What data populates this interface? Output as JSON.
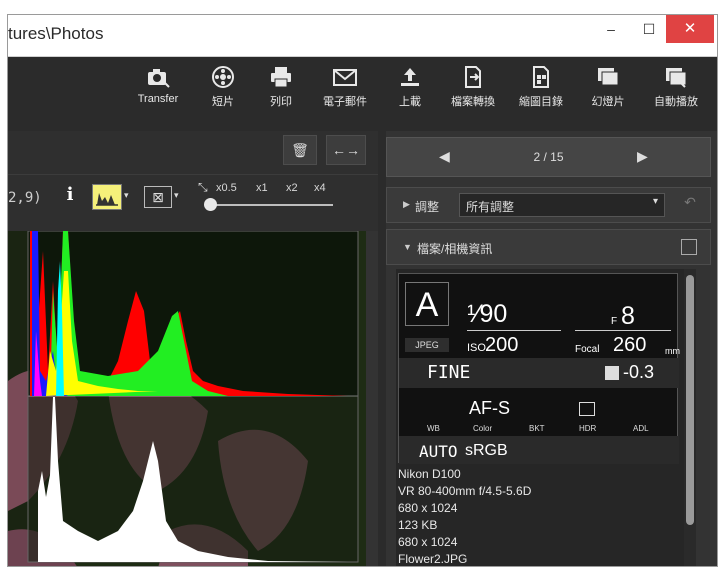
{
  "window": {
    "title": "tures\\Photos",
    "min_glyph": "‒",
    "max_glyph": "☐",
    "close_glyph": "✕"
  },
  "toolbar": {
    "items": [
      {
        "label": "Transfer",
        "icon": "camera-transfer-icon"
      },
      {
        "label": "短片",
        "icon": "film-reel-icon"
      },
      {
        "label": "列印",
        "icon": "printer-icon"
      },
      {
        "label": "電子郵件",
        "icon": "envelope-icon"
      },
      {
        "label": "上載",
        "icon": "upload-icon"
      },
      {
        "label": "檔案轉換",
        "icon": "file-convert-icon"
      },
      {
        "label": "縮圖目錄",
        "icon": "thumbnail-list-icon"
      },
      {
        "label": "幻燈片",
        "icon": "slideshow-icon"
      },
      {
        "label": "自動播放",
        "icon": "autoplay-icon"
      }
    ]
  },
  "viewer_toolbar": {
    "coords": "2,9)",
    "info_glyph": "i",
    "zoom_levels": [
      "x0.5",
      "x1",
      "x2",
      "x4"
    ],
    "zoom_fit_glyph": "⊠",
    "trash_glyph": "🗑",
    "compare_glyph": "←→"
  },
  "navigation": {
    "prev_glyph": "◀",
    "next_glyph": "▶",
    "count": "2 / 15"
  },
  "adjust": {
    "label": "調整",
    "selected": "所有調整"
  },
  "info_section": {
    "label": "檔案/相機資訊"
  },
  "shooting": {
    "mode": "A",
    "format": "JPEG",
    "shutter": "¹⁄90",
    "f_prefix": "F",
    "aperture": "8",
    "iso_label": "ISO",
    "iso": "200",
    "focal_label": "Focal",
    "focal": "260",
    "focal_unit": "mm",
    "quality": "FINE",
    "exposure_comp": "-0.3",
    "focus_mode": "AF-S",
    "meta_labels": [
      "WB",
      "Color",
      "BKT",
      "HDR",
      "ADL"
    ],
    "wb": "AUTO",
    "color_space": "sRGB"
  },
  "details": [
    "Nikon D100",
    "VR 80-400mm f/4.5-5.6D",
    "680 x 1024",
    "123 KB",
    "680 x 1024",
    "Flower2.JPG"
  ],
  "colors": {
    "close_button": "#e04343",
    "panel_bg": "#333333",
    "histogram_red": "#ff0000",
    "histogram_green": "#22ee22",
    "histogram_blue": "#1a1aff",
    "histogram_yellow": "#ffff00",
    "histogram_luminance": "#ffffff"
  }
}
